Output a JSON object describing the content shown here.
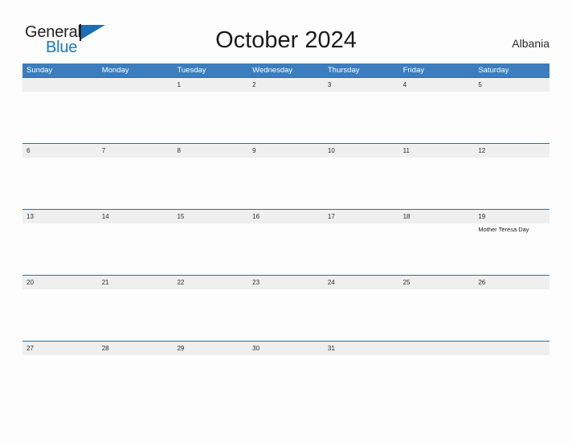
{
  "brand": {
    "name_part1": "General",
    "name_part2": "Blue",
    "flag_icon": "triangle-flag-icon",
    "color_dark": "#231f20",
    "color_blue": "#1878be"
  },
  "header": {
    "title": "October 2024",
    "country": "Albania"
  },
  "theme": {
    "header_blue": "#3b7dbd",
    "rule_blue": "#2e6da4",
    "date_band_gray": "#efefef",
    "page_background": "#fdfdfd"
  },
  "calendar": {
    "weekdays": [
      "Sunday",
      "Monday",
      "Tuesday",
      "Wednesday",
      "Thursday",
      "Friday",
      "Saturday"
    ],
    "weeks": [
      [
        {
          "date": "",
          "events": []
        },
        {
          "date": "",
          "events": []
        },
        {
          "date": "1",
          "events": []
        },
        {
          "date": "2",
          "events": []
        },
        {
          "date": "3",
          "events": []
        },
        {
          "date": "4",
          "events": []
        },
        {
          "date": "5",
          "events": []
        }
      ],
      [
        {
          "date": "6",
          "events": []
        },
        {
          "date": "7",
          "events": []
        },
        {
          "date": "8",
          "events": []
        },
        {
          "date": "9",
          "events": []
        },
        {
          "date": "10",
          "events": []
        },
        {
          "date": "11",
          "events": []
        },
        {
          "date": "12",
          "events": []
        }
      ],
      [
        {
          "date": "13",
          "events": []
        },
        {
          "date": "14",
          "events": []
        },
        {
          "date": "15",
          "events": []
        },
        {
          "date": "16",
          "events": []
        },
        {
          "date": "17",
          "events": []
        },
        {
          "date": "18",
          "events": []
        },
        {
          "date": "19",
          "events": [
            "Mother Teresa Day"
          ]
        }
      ],
      [
        {
          "date": "20",
          "events": []
        },
        {
          "date": "21",
          "events": []
        },
        {
          "date": "22",
          "events": []
        },
        {
          "date": "23",
          "events": []
        },
        {
          "date": "24",
          "events": []
        },
        {
          "date": "25",
          "events": []
        },
        {
          "date": "26",
          "events": []
        }
      ],
      [
        {
          "date": "27",
          "events": []
        },
        {
          "date": "28",
          "events": []
        },
        {
          "date": "29",
          "events": []
        },
        {
          "date": "30",
          "events": []
        },
        {
          "date": "31",
          "events": []
        },
        {
          "date": "",
          "events": []
        },
        {
          "date": "",
          "events": []
        }
      ]
    ]
  }
}
